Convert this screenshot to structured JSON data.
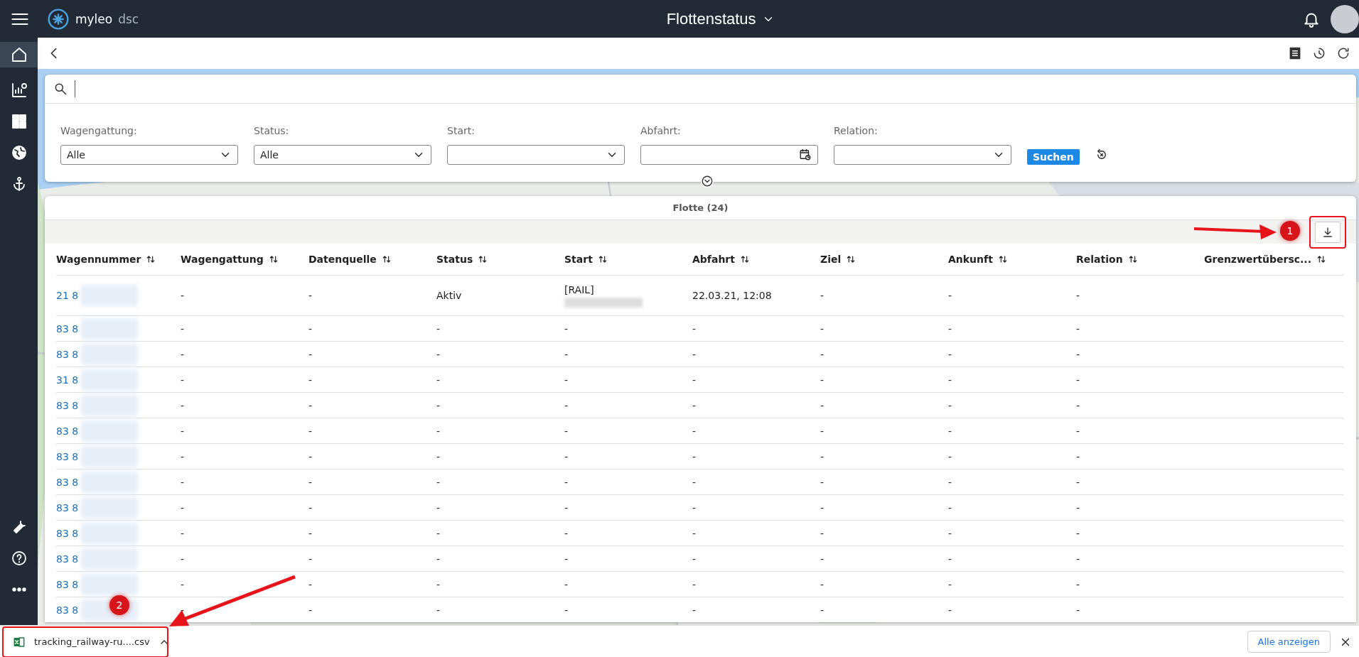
{
  "app": {
    "logo_text": "myleo",
    "logo_suffix": "dsc",
    "title": "Flottenstatus"
  },
  "filters": [
    {
      "label": "Wagengattung:",
      "kind": "select",
      "value": "Alle"
    },
    {
      "label": "Status:",
      "kind": "select",
      "value": "Alle"
    },
    {
      "label": "Start:",
      "kind": "select"
    },
    {
      "label": "Abfahrt:",
      "kind": "date"
    },
    {
      "label": "Relation:",
      "kind": "select"
    }
  ],
  "search_button": "Suchen",
  "table": {
    "title": "Flotte (24)",
    "columns": [
      "Wagennummer",
      "Wagengattung",
      "Datenquelle",
      "Status",
      "Start",
      "Abfahrt",
      "Ziel",
      "Ankunft",
      "Relation",
      "Grenzwertübersc..."
    ],
    "rows": [
      {
        "cells": [
          "21 8",
          "-",
          "-",
          "Aktiv",
          "[RAIL]",
          "22.03.21, 12:08",
          "-",
          "-",
          "-"
        ],
        "start_blurred": true
      },
      {
        "cells": [
          "83 8",
          "-",
          "-",
          "-",
          "-",
          "-",
          "-",
          "-",
          "-"
        ],
        "start_blurred": false
      },
      {
        "cells": [
          "83 8",
          "-",
          "-",
          "-",
          "-",
          "-",
          "-",
          "-",
          "-"
        ],
        "start_blurred": false
      },
      {
        "cells": [
          "31 8",
          "-",
          "-",
          "-",
          "-",
          "-",
          "-",
          "-",
          "-"
        ],
        "start_blurred": false
      },
      {
        "cells": [
          "83 8",
          "-",
          "-",
          "-",
          "-",
          "-",
          "-",
          "-",
          "-"
        ],
        "start_blurred": false
      },
      {
        "cells": [
          "83 8",
          "-",
          "-",
          "-",
          "-",
          "-",
          "-",
          "-",
          "-"
        ],
        "start_blurred": false
      },
      {
        "cells": [
          "83 8",
          "-",
          "-",
          "-",
          "-",
          "-",
          "-",
          "-",
          "-"
        ],
        "start_blurred": false
      },
      {
        "cells": [
          "83 8",
          "-",
          "-",
          "-",
          "-",
          "-",
          "-",
          "-",
          "-"
        ],
        "start_blurred": false
      },
      {
        "cells": [
          "83 8",
          "-",
          "-",
          "-",
          "-",
          "-",
          "-",
          "-",
          "-"
        ],
        "start_blurred": false
      },
      {
        "cells": [
          "83 8",
          "-",
          "-",
          "-",
          "-",
          "-",
          "-",
          "-",
          "-"
        ],
        "start_blurred": false
      },
      {
        "cells": [
          "83 8",
          "-",
          "-",
          "-",
          "-",
          "-",
          "-",
          "-",
          "-"
        ],
        "start_blurred": false
      },
      {
        "cells": [
          "83 8",
          "-",
          "-",
          "-",
          "-",
          "-",
          "-",
          "-",
          "-"
        ],
        "start_blurred": false
      },
      {
        "cells": [
          "83 8",
          "-",
          "-",
          "-",
          "-",
          "-",
          "-",
          "-",
          "-"
        ],
        "start_blurred": false
      }
    ]
  },
  "download_bar": {
    "file_name": "tracking_railway-ru....csv",
    "show_all": "Alle anzeigen"
  },
  "annotations": [
    {
      "label": "1"
    },
    {
      "label": "2"
    }
  ]
}
